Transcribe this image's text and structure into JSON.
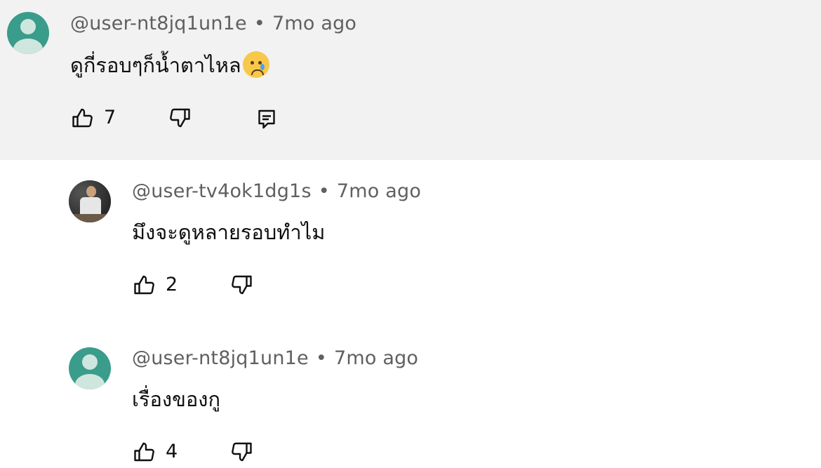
{
  "comments": [
    {
      "handle": "@user-nt8jq1un1e",
      "separator": "•",
      "time": "7mo ago",
      "text": "ดูกี่รอบๆก็น้ำตาไหล",
      "emoji": "crying-face",
      "likes": "7",
      "has_reply_button": true,
      "avatar": "default-avatar",
      "highlighted": true
    },
    {
      "handle": "@user-tv4ok1dg1s",
      "separator": "•",
      "time": "7mo ago",
      "text": "มึงจะดูหลายรอบทำไม",
      "likes": "2",
      "avatar": "photo-avatar"
    },
    {
      "handle": "@user-nt8jq1un1e",
      "separator": "•",
      "time": "7mo ago",
      "text": "เรื่องของกู",
      "likes": "4",
      "avatar": "default-avatar"
    }
  ],
  "colors": {
    "highlight_background": "#f2f2f2",
    "meta_text": "#606060",
    "body_text": "#0f0f0f",
    "default_avatar": "#3a9c8a"
  }
}
